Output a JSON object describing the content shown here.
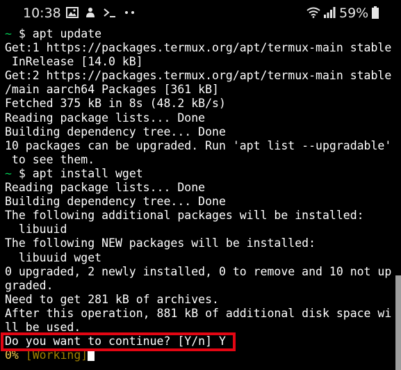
{
  "status_bar": {
    "time": "10:38",
    "battery": "59%",
    "icons": [
      "image-icon",
      "podcast-icon",
      "terminal-icon",
      "more-icon",
      "wifi-icon",
      "signal-icon",
      "battery-icon"
    ]
  },
  "terminal": {
    "colors": {
      "prompt": "#00c853",
      "text": "#ffffff",
      "progress": "#f2c94c"
    },
    "lines": [
      {
        "prompt": "~",
        "text": " $ apt update"
      },
      {
        "text": "Get:1 https://packages.termux.org/apt/termux-main stable"
      },
      {
        "text": " InRelease [14.0 kB]"
      },
      {
        "text": "Get:2 https://packages.termux.org/apt/termux-main stable"
      },
      {
        "text": "/main aarch64 Packages [361 kB]"
      },
      {
        "text": "Fetched 375 kB in 8s (48.2 kB/s)"
      },
      {
        "text": "Reading package lists... Done"
      },
      {
        "text": "Building dependency tree... Done"
      },
      {
        "text": "10 packages can be upgraded. Run 'apt list --upgradable'"
      },
      {
        "text": " to see them."
      },
      {
        "prompt": "~",
        "text": " $ apt install wget"
      },
      {
        "text": "Reading package lists... Done"
      },
      {
        "text": "Building dependency tree... Done"
      },
      {
        "text": "The following additional packages will be installed:"
      },
      {
        "text": "  libuuid"
      },
      {
        "text": "The following NEW packages will be installed:"
      },
      {
        "text": "  libuuid wget"
      },
      {
        "text": "0 upgraded, 2 newly installed, 0 to remove and 10 not up"
      },
      {
        "text": "graded."
      },
      {
        "text": "Need to get 281 kB of archives."
      },
      {
        "text": "After this operation, 881 kB of additional disk space wi"
      },
      {
        "text": "ll be used."
      },
      {
        "text": "Do you want to continue? [Y/n] Y"
      }
    ],
    "progress": {
      "percent": "0%",
      "status": " [Working]"
    }
  }
}
